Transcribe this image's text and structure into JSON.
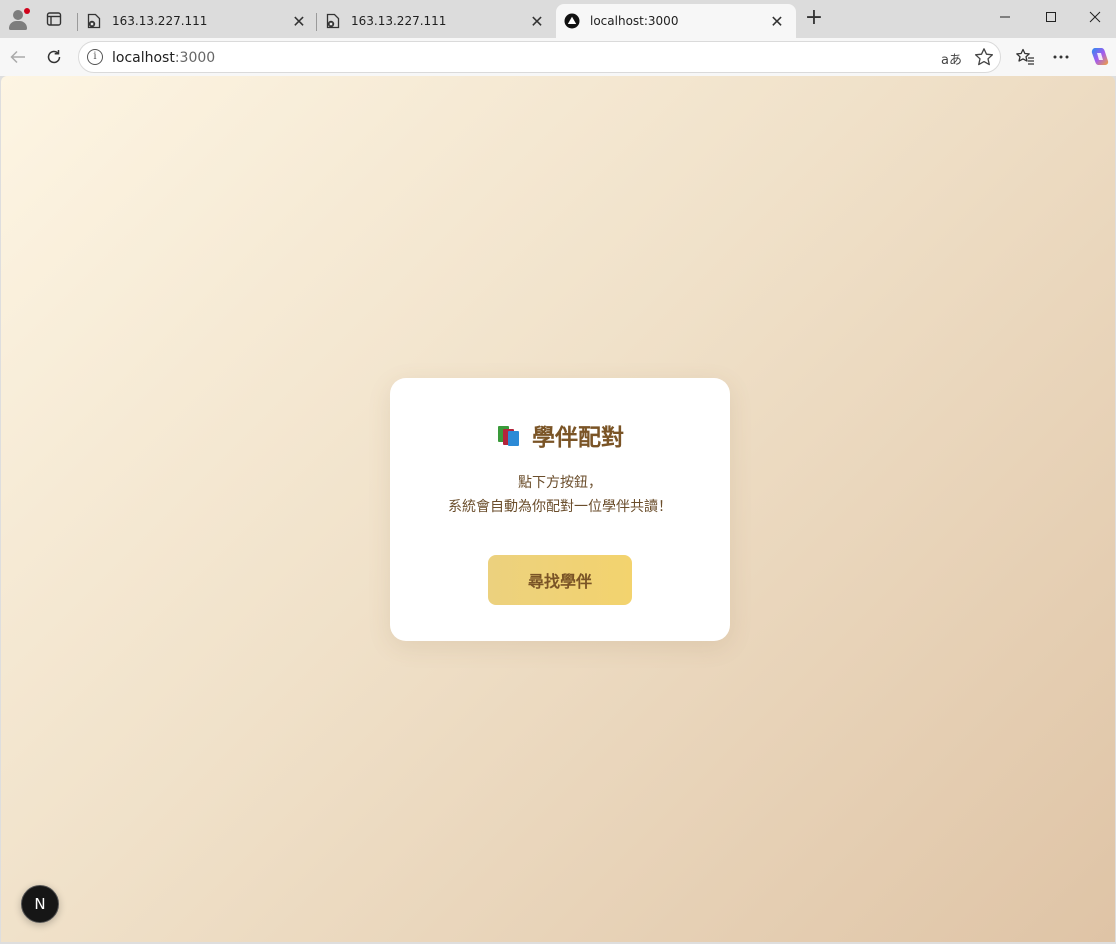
{
  "browser": {
    "tabs": [
      {
        "title": "163.13.227.111",
        "active": false
      },
      {
        "title": "163.13.227.111",
        "active": false
      },
      {
        "title": "localhost:3000",
        "active": true
      }
    ],
    "address": {
      "host": "localhost",
      "port": ":3000"
    },
    "read_aloud_label": "aあ",
    "icons": [
      "profile-icon",
      "tab-actions-icon",
      "back-icon",
      "refresh-icon",
      "info-icon",
      "star-icon",
      "favorites-icon",
      "more-icon",
      "copilot-icon",
      "minimize-icon",
      "maximize-icon",
      "close-icon"
    ]
  },
  "page": {
    "title": "學伴配對",
    "description_line1": "點下方按鈕，",
    "description_line2": "系統會自動為你配對一位學伴共讀！",
    "button_label": "尋找學伴",
    "nextjs_badge": "N",
    "colors": {
      "background_start": "#fdf5e3",
      "background_end": "#dfc4a6",
      "title": "#7a5426",
      "button": "#f3d36e"
    }
  }
}
